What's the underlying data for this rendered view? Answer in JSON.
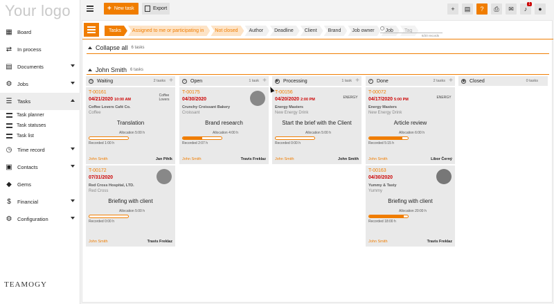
{
  "sidebar": {
    "logo": "Your logo",
    "items": [
      {
        "label": "Board",
        "icon": "grid-icon",
        "glyph": "▦",
        "caret": false
      },
      {
        "label": "In process",
        "icon": "flow-icon",
        "glyph": "⇄",
        "caret": false
      },
      {
        "label": "Documents",
        "icon": "document-icon",
        "glyph": "▤",
        "caret": true
      },
      {
        "label": "Jobs",
        "icon": "gears-icon",
        "glyph": "⚙",
        "caret": true
      },
      {
        "label": "Tasks",
        "icon": "tasks-icon",
        "glyph": "☰",
        "caret": true,
        "active": true
      },
      {
        "label": "Time record",
        "icon": "clock-icon",
        "glyph": "◷",
        "caret": true
      },
      {
        "label": "Contacts",
        "icon": "contacts-icon",
        "glyph": "▣",
        "caret": true
      },
      {
        "label": "Gems",
        "icon": "gem-icon",
        "glyph": "◆",
        "caret": false
      },
      {
        "label": "Financial",
        "icon": "dollar-icon",
        "glyph": "$",
        "caret": true
      },
      {
        "label": "Configuration",
        "icon": "cog-icon",
        "glyph": "⚙",
        "caret": true
      }
    ],
    "sub_items": [
      "Task planner",
      "Task statuses",
      "Task list"
    ],
    "brand": "TEAMOGY"
  },
  "topbar": {
    "new_task_label": "New task",
    "export_label": "Export",
    "icons": [
      {
        "name": "add-icon",
        "glyph": "+"
      },
      {
        "name": "notes-icon",
        "glyph": "▤"
      },
      {
        "name": "help-icon",
        "glyph": "?",
        "accent": true
      },
      {
        "name": "print-icon",
        "glyph": "⎙"
      },
      {
        "name": "chat-icon",
        "glyph": "✉"
      },
      {
        "name": "bell-icon",
        "glyph": "♪",
        "badge": "1"
      },
      {
        "name": "user-icon",
        "glyph": "●"
      }
    ]
  },
  "filters": {
    "chips": [
      "Tasks",
      "Assigned to me or participating in",
      "Not closed",
      "Author",
      "Deadline",
      "Client",
      "Brand",
      "Job owner",
      "Job",
      "Tag"
    ],
    "records": "6/20 records"
  },
  "board": {
    "collapse_all": "Collapse all",
    "collapse_count": "6 tasks",
    "group_name": "John Smith",
    "group_count": "6 tasks",
    "columns": [
      {
        "name": "Waiting",
        "count": "2 tasks",
        "icon": "clock-status-icon",
        "glyph": "◷"
      },
      {
        "name": "Open",
        "count": "1 task",
        "icon": "open-status-icon",
        "glyph": "○"
      },
      {
        "name": "Processing",
        "count": "1 task",
        "icon": "play-status-icon",
        "glyph": "▶"
      },
      {
        "name": "Done",
        "count": "2 tasks",
        "icon": "check-status-icon",
        "glyph": "✓"
      },
      {
        "name": "Closed",
        "count": "0 tasks",
        "icon": "closed-status-icon",
        "glyph": "◉"
      }
    ],
    "cards": [
      {
        "id": "T-00161",
        "date": "04/21/2020",
        "time": "10:00 AM",
        "client": "Coffee Lovers Café Co.",
        "job": "Coffee",
        "title": "Translation",
        "alloc": "Allocation 5:00 h",
        "progress": 0,
        "recorded": "Recorded 1:00 h",
        "owner": "John Smith",
        "worker": "Jan Pihlk",
        "logo": "Coffee Lovers"
      },
      {
        "id": "T-00175",
        "date": "04/30/2020",
        "time": "",
        "client": "Crunchy Croissant Bakery",
        "job": "Croissant",
        "title": "Brand research",
        "alloc": "Allocation 4:00 h",
        "progress": 0.5,
        "recorded": "Recorded 2:07 h",
        "owner": "John Smith",
        "worker": "Travis Freklaz",
        "logo": ""
      },
      {
        "id": "T-00156",
        "date": "04/20/2020",
        "time": "2:00 PM",
        "client": "Energy Masters",
        "job": "New Energy Drink",
        "title": "Start the brief with the Client",
        "alloc": "Allocation 5:00 h",
        "progress": 0,
        "recorded": "Recorded 0:00 h",
        "owner": "John Smith",
        "worker": "John Smith",
        "logo": "ENERGY"
      },
      {
        "id": "T-00072",
        "date": "04/17/2020",
        "time": "5:00 PM",
        "client": "Energy Masters",
        "job": "New Energy Drink",
        "title": "Article review",
        "alloc": "Allocation 6:00 h",
        "progress": 0.85,
        "recorded": "Recorded 5:15 h",
        "owner": "John Smith",
        "worker": "Libor Černý",
        "logo": "ENERGY"
      },
      {
        "id": "T-00172",
        "date": "07/31/2020",
        "time": "",
        "client": "Red Cross Hospital, LTD.",
        "job": "Red Cross",
        "title": "Briefing with client",
        "alloc": "Allocation 5:00 h",
        "progress": 0,
        "recorded": "Recorded 0:00 h",
        "owner": "John Smith",
        "worker": "Travis Freklaz",
        "logo": ""
      },
      {
        "id": "T-00163",
        "date": "04/30/2020",
        "time": "",
        "client": "Yummy & Tasty",
        "job": "Yummy",
        "title": "Briefing with client",
        "alloc": "Allocation 20:00 h",
        "progress": 0.9,
        "recorded": "Recorded 18:00 h",
        "owner": "John Smith",
        "worker": "Travis Freklaz",
        "logo": ""
      }
    ]
  },
  "colors": {
    "accent": "#f07d00",
    "date": "#cc0000"
  }
}
